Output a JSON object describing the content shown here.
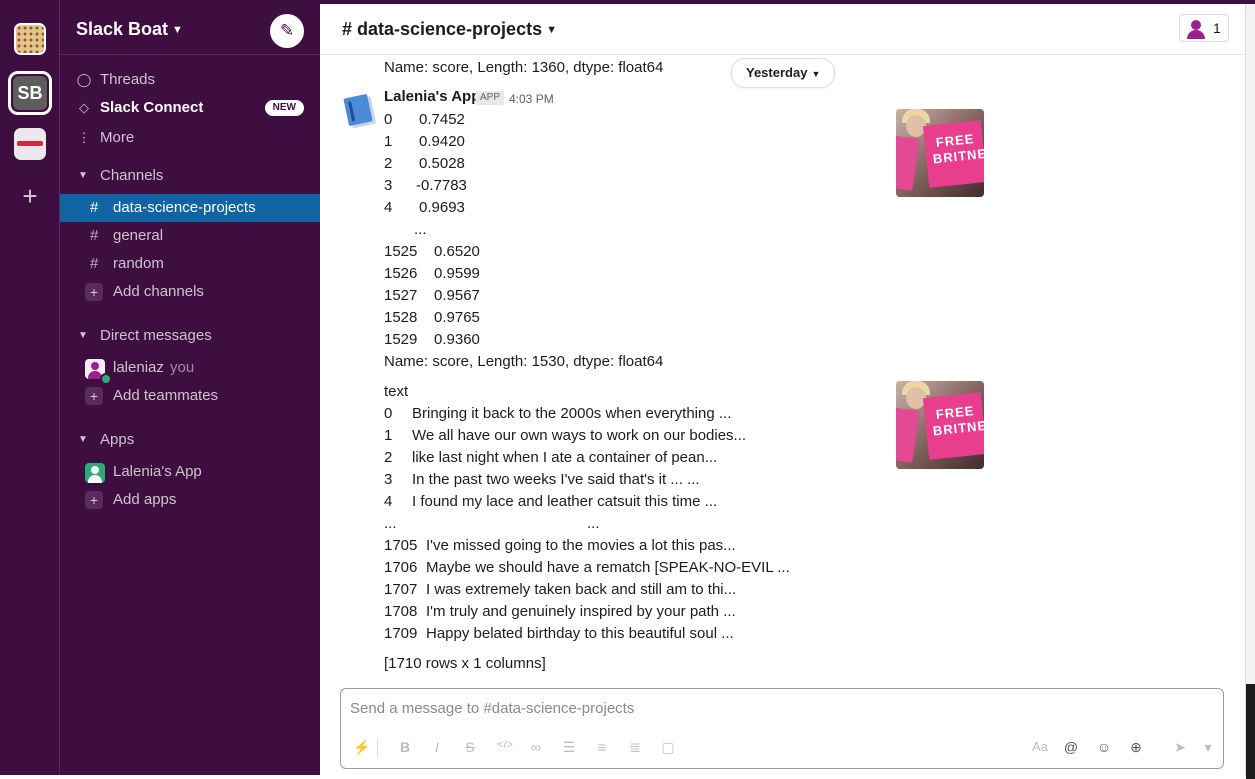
{
  "workspaces": [
    {
      "name": "workspace-1"
    },
    {
      "initials": "SB"
    },
    {
      "name": "workspace-3"
    }
  ],
  "sidebar": {
    "workspace_name": "Slack Boat",
    "nav": {
      "threads": "Threads",
      "slack_connect": "Slack Connect",
      "new_badge": "NEW",
      "more": "More"
    },
    "channels_header": "Channels",
    "channels": [
      "data-science-projects",
      "general",
      "random"
    ],
    "add_channels": "Add channels",
    "dm_header": "Direct messages",
    "dm_user": "laleniaz",
    "dm_you": "you",
    "add_teammates": "Add teammates",
    "apps_header": "Apps",
    "app_name": "Lalenia's App",
    "add_apps": "Add apps"
  },
  "channel": {
    "title": "# data-science-projects",
    "member_count": "1"
  },
  "messages": {
    "prev_tail": "Name: score, Length: 1360, dtype: float64",
    "date_divider": "Yesterday",
    "sender": "Lalenia's App",
    "app_tag": "APP",
    "time": "4:03 PM",
    "block1": {
      "rows": [
        {
          "idx": "0",
          "val": "0.7452"
        },
        {
          "idx": "1",
          "val": "0.9420"
        },
        {
          "idx": "2",
          "val": "0.5028"
        },
        {
          "idx": "3",
          "val": "-0.7783"
        },
        {
          "idx": "4",
          "val": "0.9693"
        },
        {
          "idx": "",
          "val": "..."
        },
        {
          "idx": "1525",
          "val": "0.6520"
        },
        {
          "idx": "1526",
          "val": "0.9599"
        },
        {
          "idx": "1527",
          "val": "0.9567"
        },
        {
          "idx": "1528",
          "val": "0.9765"
        },
        {
          "idx": "1529",
          "val": "0.9360"
        }
      ],
      "footer": "Name: score, Length: 1530, dtype: float64",
      "image_text": "FREE BRITNEY"
    },
    "block2": {
      "header": "text",
      "rows": [
        {
          "idx": "0",
          "val": "Bringing it back to the 2000s when everything ..."
        },
        {
          "idx": "1",
          "val": "We all have our own ways to work on our bodies..."
        },
        {
          "idx": "2",
          "val": "like last night when I ate a container of pean..."
        },
        {
          "idx": "3",
          "val": "In the past two weeks I've said that's it ... ..."
        },
        {
          "idx": "4",
          "val": "I found my lace and leather catsuit this time ..."
        },
        {
          "idx": "...",
          "val": "..."
        },
        {
          "idx": "1705",
          "val": "I've missed going to the movies a lot this pas..."
        },
        {
          "idx": "1706",
          "val": "Maybe we should have a rematch [SPEAK-NO-EVIL ..."
        },
        {
          "idx": "1707",
          "val": "I was extremely taken back and still am to thi..."
        },
        {
          "idx": "1708",
          "val": "I'm truly and genuinely inspired by your path ..."
        },
        {
          "idx": "1709",
          "val": "Happy belated birthday to this beautiful soul ..."
        }
      ],
      "footer": "[1710 rows x 1 columns]",
      "image_text": "FREE BRITNEY"
    }
  },
  "composer": {
    "placeholder": "Send a message to #data-science-projects",
    "tools_left": [
      "shortcuts-icon",
      "bold-icon",
      "italic-icon",
      "strikethrough-icon",
      "code-icon",
      "link-icon",
      "ordered-list-icon",
      "bulleted-list-icon",
      "indent-icon",
      "code-block-icon"
    ],
    "tools_right": [
      "formatting-icon",
      "mention-icon",
      "emoji-icon",
      "attach-icon",
      "send-icon",
      "send-options-icon"
    ]
  },
  "colors": {
    "sidebar_bg": "#3f0e40",
    "active_channel": "#1164a3",
    "presence_green": "#2bac76",
    "brand_pink": "#e93d8e"
  }
}
